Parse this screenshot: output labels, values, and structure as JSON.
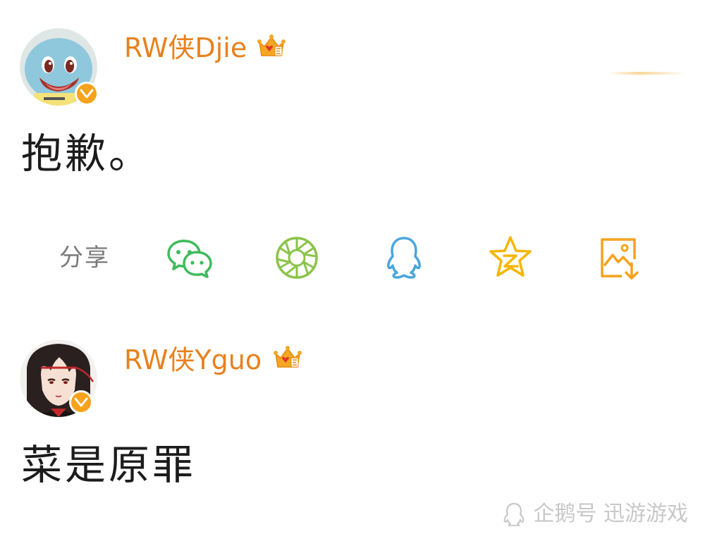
{
  "posts": [
    {
      "username": "RW侠Djie",
      "text": "抱歉。"
    },
    {
      "username": "RW侠Yguo",
      "text": "菜是原罪"
    }
  ],
  "share": {
    "label": "分享",
    "targets": [
      {
        "icon": "wechat-icon",
        "color": "#3fba5c"
      },
      {
        "icon": "moments-icon",
        "color": "#8bc34a"
      },
      {
        "icon": "qq-icon",
        "color": "#4aa6dc"
      },
      {
        "icon": "qzone-icon",
        "color": "#f7b500"
      },
      {
        "icon": "save-image-icon",
        "color": "#f7a21b"
      }
    ]
  },
  "colors": {
    "username": "#e8811e",
    "badge": "#f7a21b",
    "text": "#1c1c1c",
    "share_label": "#7a7a7a"
  },
  "watermark": {
    "icon": "penguin-icon",
    "text": "企鹅号 迅游游戏"
  }
}
